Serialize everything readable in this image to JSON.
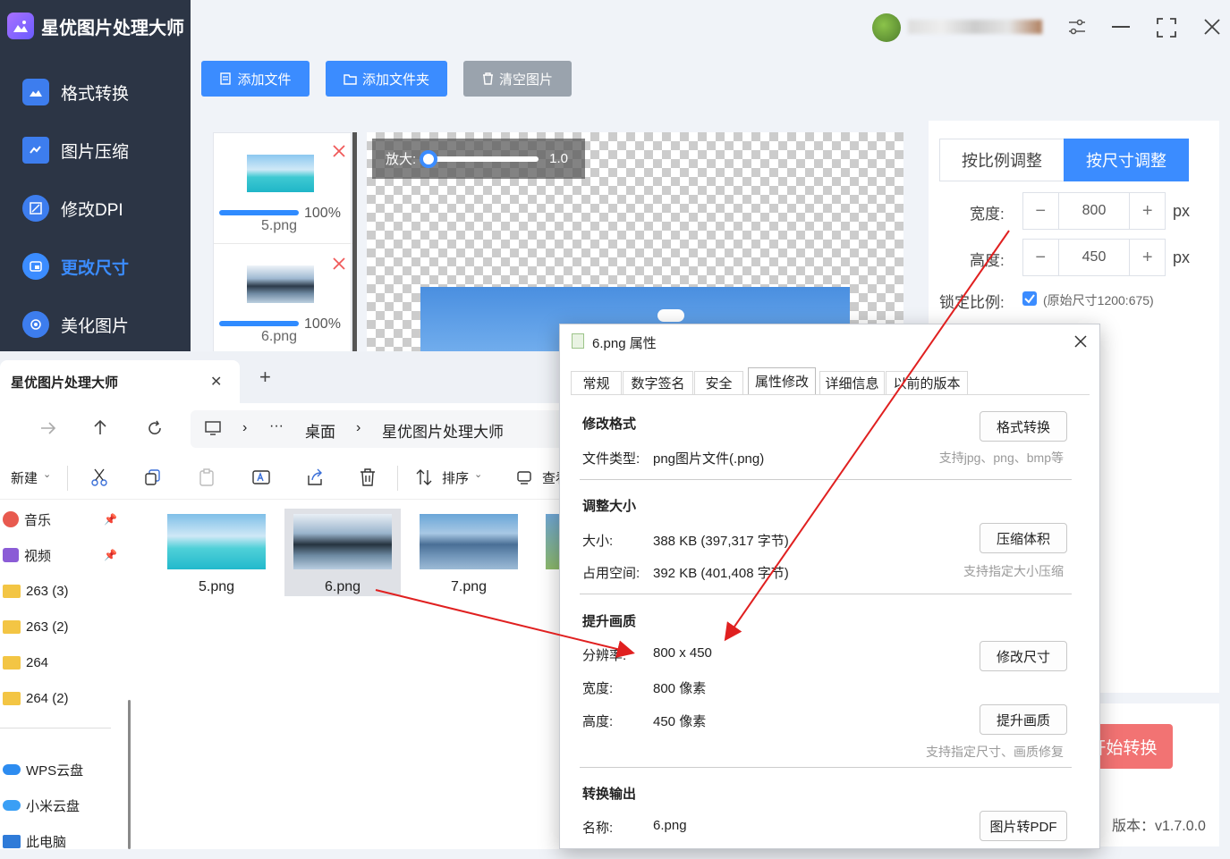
{
  "app": {
    "title": "星优图片处理大师",
    "nav": [
      {
        "label": "格式转换"
      },
      {
        "label": "图片压缩"
      },
      {
        "label": "修改DPI"
      },
      {
        "label": "更改尺寸"
      },
      {
        "label": "美化图片"
      }
    ],
    "toolbar": {
      "add_file": "添加文件",
      "add_folder": "添加文件夹",
      "clear": "清空图片"
    },
    "files": [
      {
        "name": "5.png",
        "progress": "100%"
      },
      {
        "name": "6.png",
        "progress": "100%"
      }
    ],
    "zoom": {
      "label": "放大:",
      "value": "1.0"
    },
    "resize": {
      "tab_ratio": "按比例调整",
      "tab_size": "按尺寸调整",
      "width_label": "宽度:",
      "width_value": "800",
      "height_label": "高度:",
      "height_value": "450",
      "unit": "px",
      "lock_label": "锁定比例:",
      "lock_hint": "(原始尺寸1200:675)",
      "minus": "−",
      "plus": "+"
    },
    "start_button": "开始转换",
    "version": "版本：v1.7.0.0"
  },
  "explorer": {
    "tab_title": "星优图片处理大师",
    "tab_close": "✕",
    "new_tab": "+",
    "breadcrumb": [
      "桌面",
      "星优图片处理大师"
    ],
    "more": "···",
    "new_label": "新建",
    "sort_label": "排序",
    "view_label": "查看",
    "sidebar": [
      {
        "label": "音乐"
      },
      {
        "label": "视频"
      },
      {
        "label": "263 (3)"
      },
      {
        "label": "263 (2)"
      },
      {
        "label": "264"
      },
      {
        "label": "264 (2)"
      },
      {
        "label": "WPS云盘"
      },
      {
        "label": "小米云盘"
      },
      {
        "label": "此电脑"
      }
    ],
    "files": [
      {
        "name": "5.png"
      },
      {
        "name": "6.png"
      },
      {
        "name": "7.png"
      }
    ]
  },
  "dialog": {
    "title": "6.png 属性",
    "tabs": [
      "常规",
      "数字签名",
      "安全",
      "属性修改",
      "详细信息",
      "以前的版本"
    ],
    "sections": {
      "format": "修改格式",
      "size": "调整大小",
      "quality": "提升画质",
      "output": "转换输出"
    },
    "file_type_label": "文件类型:",
    "file_type_value": "png图片文件(.png)",
    "format_button": "格式转换",
    "format_hint": "支持jpg、png、bmp等",
    "size_label": "大小:",
    "size_value": "388 KB (397,317 字节)",
    "space_label": "占用空间:",
    "space_value": "392 KB (401,408 字节)",
    "compress_button": "压缩体积",
    "compress_hint": "支持指定大小压缩",
    "resolution_label": "分辨率:",
    "resolution_value": "800 x 450",
    "width_label": "宽度:",
    "width_value": "800 像素",
    "height_label": "高度:",
    "height_value": "450 像素",
    "resize_button": "修改尺寸",
    "enhance_button": "提升画质",
    "enhance_hint": "支持指定尺寸、画质修复",
    "name_label": "名称:",
    "name_value": "6.png",
    "pdf_button": "图片转PDF"
  },
  "colors": {
    "sidebar_bg": "#2c3545",
    "accent": "#3b8cff",
    "arrow": "#e02020",
    "start_button": "#f27373"
  }
}
